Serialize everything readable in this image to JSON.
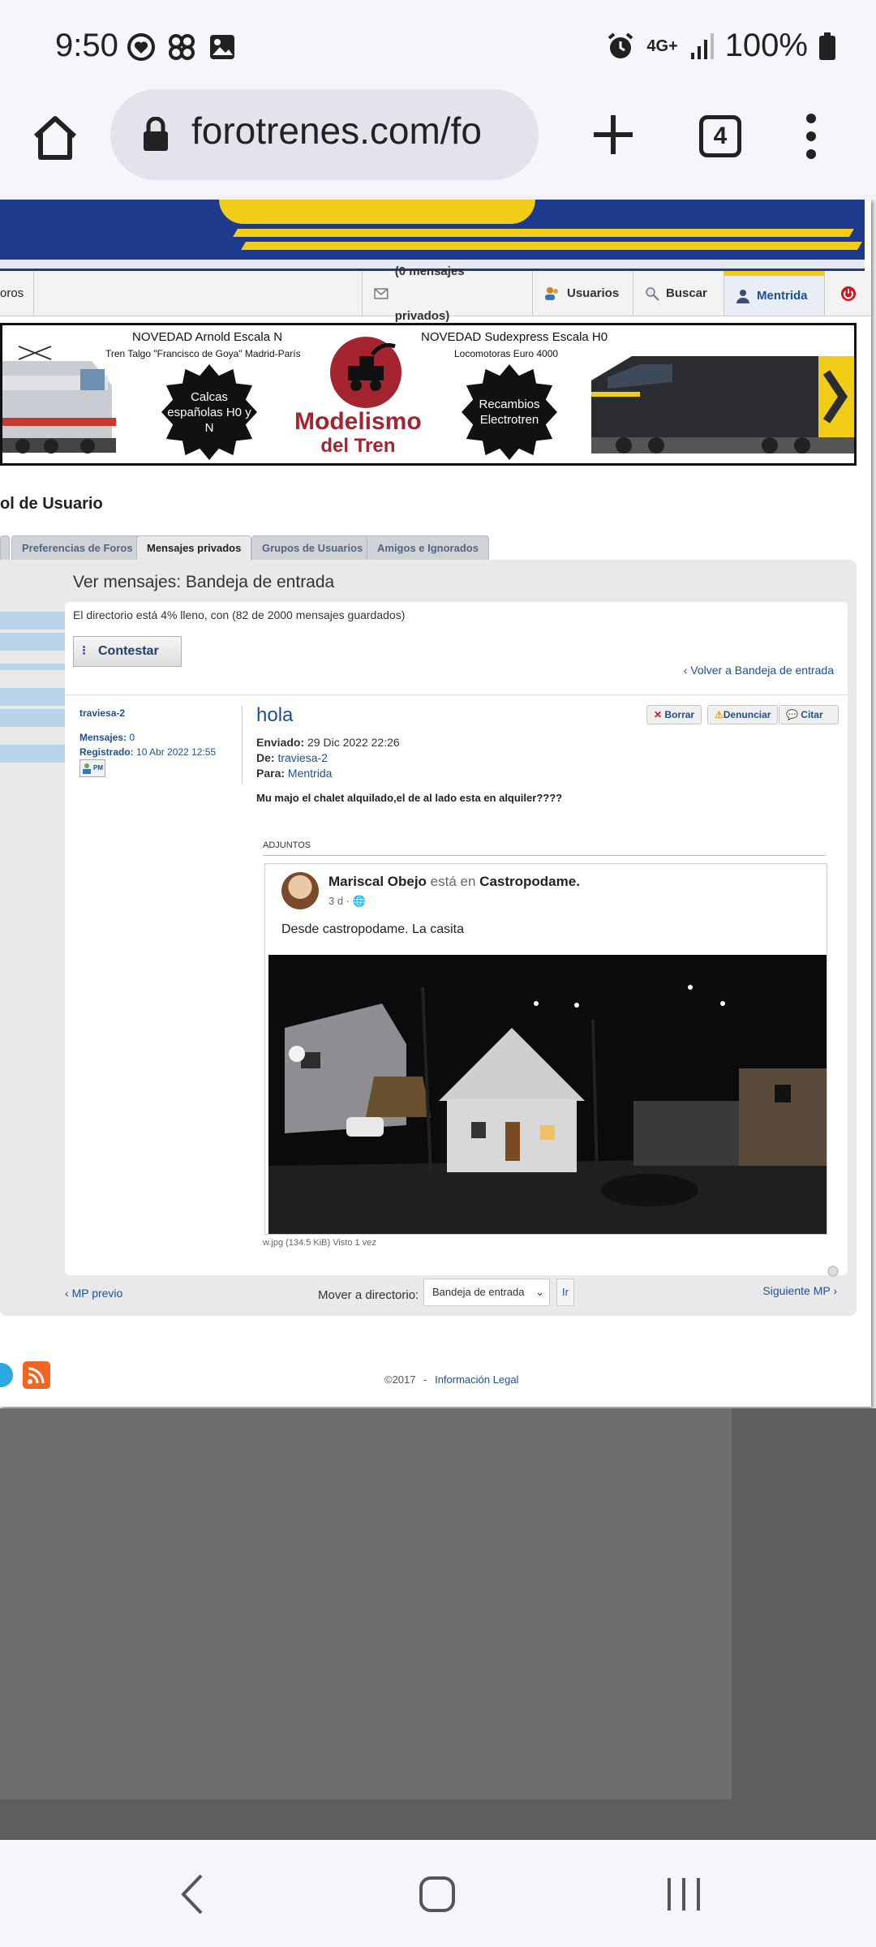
{
  "status_bar": {
    "time": "9:50",
    "network": "4G+",
    "battery": "100%",
    "left_icons": [
      "heart-icon",
      "pinwheel-icon",
      "image-icon"
    ],
    "right_icons": [
      "alarm-icon",
      "signal-icon",
      "battery-icon"
    ]
  },
  "browser": {
    "url": "forotrenes.com/fo",
    "tab_count": "4"
  },
  "navbar": {
    "left_text": "oros",
    "items": [
      "(0 mensajes privados)",
      "Usuarios",
      "Buscar",
      "Mentrida"
    ]
  },
  "banner": {
    "line1": "NOVEDAD Arnold Escala N",
    "line2": "Tren Talgo \"Francisco de Goya\" Madrid-París",
    "line3": "NOVEDAD Sudexpress Escala H0",
    "line4": "Locomotoras Euro 4000",
    "badge1": "Calcas españolas H0 y N",
    "badge2": "Recambios Electrotren",
    "brand1": "Modelismo",
    "brand2": "del Tren"
  },
  "panel": {
    "title": "ol de Usuario",
    "tabs": [
      "Preferencias de Foros",
      "Mensajes privados",
      "Grupos de Usuarios",
      "Amigos e Ignorados"
    ]
  },
  "inbox": {
    "heading": "Ver mensajes: Bandeja de entrada",
    "directory_info": "El directorio está 4% lleno, con (82 de 2000 mensajes guardados)",
    "reply_label": "Contestar",
    "back_label": "Volver a Bandeja de entrada"
  },
  "post": {
    "author": "traviesa-2",
    "posts_label": "Mensajes:",
    "posts_value": "0",
    "registered_label": "Registrado:",
    "registered_value": "10 Abr 2022 12:55",
    "pm_label": "PM",
    "subject": "hola",
    "buttons": [
      "Borrar",
      "Denunciar",
      "Citar"
    ],
    "sent_label": "Enviado:",
    "sent_value": "29 Dic 2022 22:26",
    "from_label": "De:",
    "from_value": "traviesa-2",
    "to_label": "Para:",
    "to_value": "Mentrida",
    "message": "Mu majo el chalet alquilado,el de al lado esta en alquiler????",
    "attachments_label": "ADJUNTOS",
    "attachment": {
      "name": "Mariscal Obejo",
      "verb": "está en",
      "place": "Castropodame.",
      "time": "3 d ·",
      "text": "Desde castropodame. La casita"
    },
    "file_info": "w.jpg (134.5 KiB) Visto 1 vez"
  },
  "pager": {
    "prev": "MP previo",
    "move_label": "Mover a directorio:",
    "select_value": "Bandeja de entrada",
    "go_label": "Ir",
    "next": "Siguiente MP"
  },
  "footer": {
    "copyright": "©2017",
    "separator": "-",
    "legal": "Información Legal"
  },
  "colors": {
    "link": "#1c4f95",
    "header_blue": "#1d3a8c",
    "header_yellow": "#f2cd18",
    "page_gray": "#e9e9e9"
  }
}
